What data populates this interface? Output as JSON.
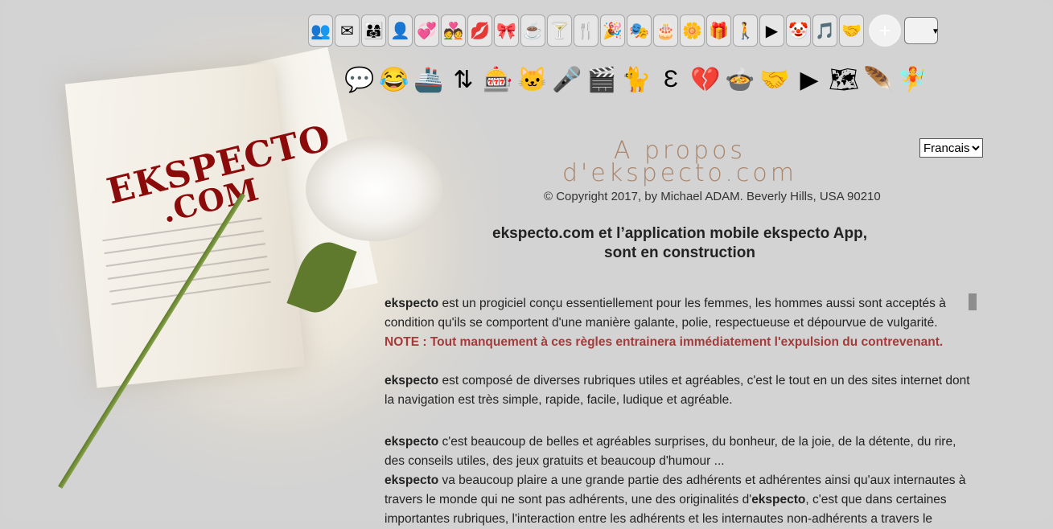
{
  "toolbar": {
    "row1_icons": [
      {
        "name": "people-group-icon",
        "glyph": "👥"
      },
      {
        "name": "mail-icon",
        "glyph": "✉"
      },
      {
        "name": "community-icon",
        "glyph": "👨‍👩‍👧"
      },
      {
        "name": "contacts-icon",
        "glyph": "👤"
      },
      {
        "name": "hearts-icon",
        "glyph": "💞"
      },
      {
        "name": "couple-icon",
        "glyph": "💑"
      },
      {
        "name": "kiss-icon",
        "glyph": "💋"
      },
      {
        "name": "ribbon-icon",
        "glyph": "🎀"
      },
      {
        "name": "coffee-icon",
        "glyph": "☕"
      },
      {
        "name": "cocktail-icon",
        "glyph": "🍸"
      },
      {
        "name": "restaurant-icon",
        "glyph": "🍴"
      },
      {
        "name": "party-popper-icon",
        "glyph": "🎉"
      },
      {
        "name": "theater-masks-icon",
        "glyph": "🎭"
      },
      {
        "name": "birthday-cake-icon",
        "glyph": "🎂"
      },
      {
        "name": "flower-icon",
        "glyph": "🌼"
      },
      {
        "name": "gift-icon",
        "glyph": "🎁"
      },
      {
        "name": "walking-icon",
        "glyph": "🚶"
      },
      {
        "name": "play-icon",
        "glyph": "▶"
      },
      {
        "name": "jester-icon",
        "glyph": "🤡"
      },
      {
        "name": "music-note-icon",
        "glyph": "🎵"
      },
      {
        "name": "handshake-icon",
        "glyph": "🤝"
      }
    ],
    "row2_icons": [
      {
        "name": "chat-bubbles-icon",
        "glyph": "💬"
      },
      {
        "name": "laughing-face-icon",
        "glyph": "😂"
      },
      {
        "name": "cruise-ship-icon",
        "glyph": "🚢"
      },
      {
        "name": "exchange-arrows-icon",
        "glyph": "⇅"
      },
      {
        "name": "slot-machine-icon",
        "glyph": "🎰"
      },
      {
        "name": "cat-icon",
        "glyph": "🐱"
      },
      {
        "name": "microphone-icon",
        "glyph": "🎤"
      },
      {
        "name": "clapperboard-icon",
        "glyph": "🎬"
      },
      {
        "name": "cat-computer-icon",
        "glyph": "🐈"
      },
      {
        "name": "logo-e-icon",
        "glyph": "Ɛ"
      },
      {
        "name": "broken-heart-icon",
        "glyph": "💔"
      },
      {
        "name": "cooking-pot-icon",
        "glyph": "🍲"
      },
      {
        "name": "handshake-deal-icon",
        "glyph": "🤝"
      },
      {
        "name": "play-triangle-icon",
        "glyph": "▶"
      },
      {
        "name": "world-map-search-icon",
        "glyph": "🗺"
      },
      {
        "name": "feather-pen-icon",
        "glyph": "🪶"
      },
      {
        "name": "fairy-icon",
        "glyph": "🧚"
      }
    ],
    "zoom_plus": "+"
  },
  "language": {
    "selected": "Francais"
  },
  "about": {
    "title_line1": "A propos",
    "title_line2": "d'ekspecto.com",
    "copyright": "© Copyright 2017, by Michael ADAM. Beverly Hills, USA 90210"
  },
  "headline": {
    "line1": "ekspecto.com et l’application mobile ekspecto App,",
    "line2": "sont en construction"
  },
  "hero": {
    "logo_line1": "EKSPECTO",
    "logo_line2": ".COM"
  },
  "content": {
    "p1_brand": "ekspecto",
    "p1_text": " est un progiciel conçu essentiellement pour les femmes, les hommes aussi sont    acceptés à condition qu'ils se comportent d'une manière galante, polie, respectueuse et dépourvue de vulgarité.",
    "note": "NOTE : Tout manquement à ces règles entrainera immédiatement l'expulsion du contrevenant.",
    "p2_brand": "ekspecto",
    "p2_text": " est composé de diverses rubriques utiles et agréables, c'est le tout en un des sites internet dont la navigation est très simple, rapide, facile, ludique et agréable.",
    "p3_brand": "ekspecto",
    "p3_text": " c'est beaucoup de belles et agréables surprises, du bonheur, de la joie, de la détente, du rire, des conseils utiles, des jeux gratuits et beaucoup d'humour ...",
    "p4_brand": "ekspecto",
    "p4_text_a": " va beaucoup plaire a une grande partie des adhérents et adhérentes ainsi qu'aux internautes à travers le monde qui ne sont pas adhérents, une des originalités d'",
    "p4_brand2": "ekspecto",
    "p4_text_b": ", c'est que dans certaines importantes rubriques, l'interaction entre les adhérents et les internautes non-adhérents a travers le"
  }
}
